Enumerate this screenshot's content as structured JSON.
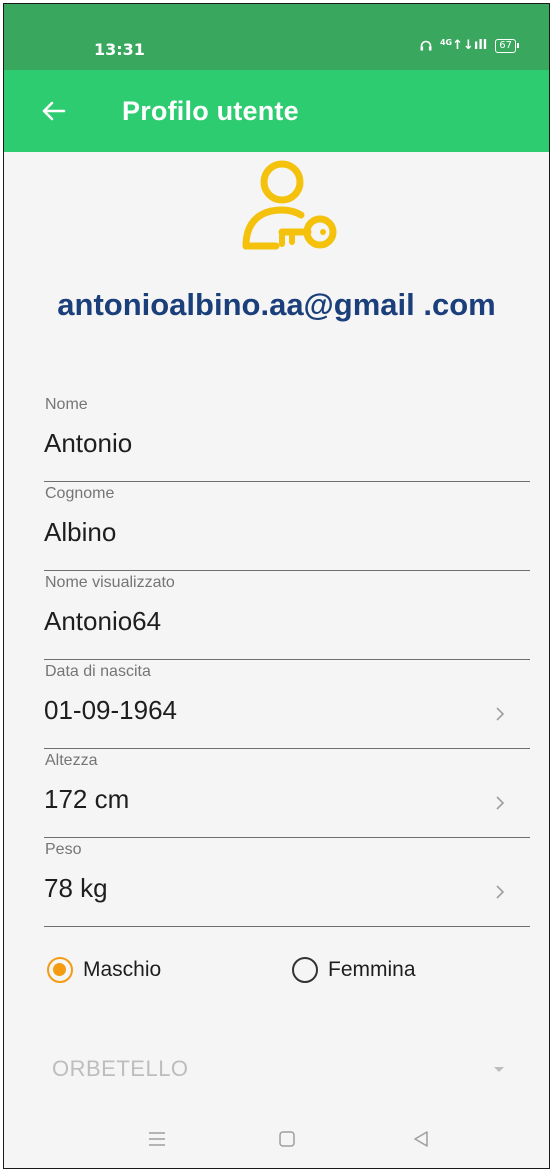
{
  "status_bar": {
    "time": "13:31",
    "signal": "4G",
    "battery": "67"
  },
  "app_bar": {
    "title": "Profilo utente"
  },
  "profile": {
    "email": "antonioalbino.aa@gmail .com"
  },
  "fields": [
    {
      "label": "Nome",
      "value": "Antonio"
    },
    {
      "label": "Cognome",
      "value": "Albino"
    },
    {
      "label": "Nome visualizzato",
      "value": "Antonio64"
    },
    {
      "label": "Data di nascita",
      "value": "01-09-1964"
    },
    {
      "label": "Altezza",
      "value": "172 cm"
    },
    {
      "label": "Peso",
      "value": "78 kg"
    }
  ],
  "gender": {
    "options": [
      {
        "label": "Maschio",
        "selected": true
      },
      {
        "label": "Femmina",
        "selected": false
      }
    ]
  },
  "city": {
    "selected": "ORBETELLO"
  },
  "colors": {
    "status_bar": "#3aa75e",
    "app_bar": "#2ecc71",
    "email": "#1b3f7a",
    "avatar": "#f4c20d",
    "radio_selected": "#f39c12"
  },
  "icons": {
    "back": "arrow-left-icon",
    "avatar": "user-key-icon",
    "chevron": "chevron-right-icon",
    "nav": [
      "menu-icon",
      "home-icon",
      "back-triangle-icon"
    ]
  }
}
